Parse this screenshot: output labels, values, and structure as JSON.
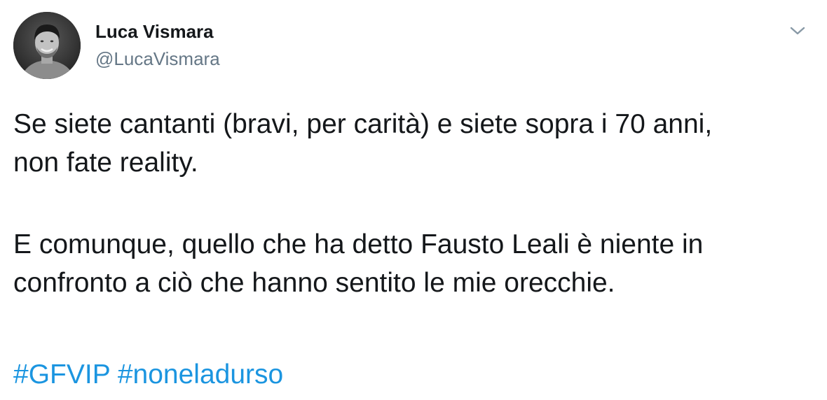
{
  "author": {
    "display_name": "Luca Vismara",
    "handle": "@LucaVismara"
  },
  "tweet": {
    "lines_p1": [
      "Se siete cantanti (bravi, per carità) e siete sopra i 70 anni,",
      "non fate reality."
    ],
    "lines_p2": [
      "E comunque, quello che ha detto Fausto Leali è niente in",
      "confronto a ciò che hanno sentito le mie orecchie."
    ],
    "hashtags": [
      "#GFVIP",
      "#noneladurso"
    ]
  },
  "icons": {
    "menu": "chevron-down-icon"
  },
  "colors": {
    "text": "#14171a",
    "secondary": "#657786",
    "link": "#1b95e0"
  }
}
